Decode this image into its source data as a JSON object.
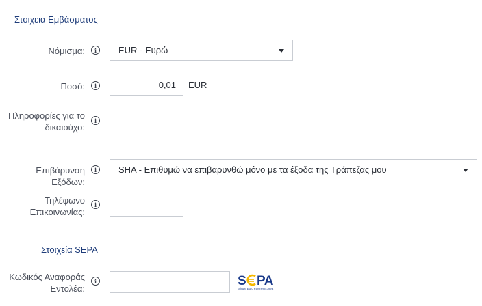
{
  "sections": {
    "remittance_title": "Στοιχεια Εμβάσματος",
    "sepa_title": "Στοιχεία SEPA"
  },
  "fields": {
    "currency": {
      "label": "Νόμισμα:",
      "value": "EUR - Ευρώ"
    },
    "amount": {
      "label": "Ποσό:",
      "value": "0,01",
      "unit": "EUR"
    },
    "beneficiary_info": {
      "label_line1": "Πληροφορίες για το",
      "label_line2": "δικαιούχο:",
      "value": ""
    },
    "charges": {
      "label": "Επιβάρυνση Εξόδων:",
      "value": "SHA - Επιθυμώ να επιβαρυνθώ μόνο με τα έξοδα της Τράπεζας μου"
    },
    "phone": {
      "label_line1": "Τηλέφωνο",
      "label_line2": "Επικοινωνίας:",
      "value": ""
    },
    "mandate_ref": {
      "label_line1": "Κωδικός Αναφοράς",
      "label_line2": "Εντολέα:",
      "value": ""
    }
  },
  "sepa_logo": {
    "wordmark": "SEPA",
    "tagline": "Single Euro Payments Area"
  },
  "icons": {
    "info": "info-icon",
    "dropdown": "chevron-down-icon"
  },
  "colors": {
    "section_title": "#1f3d7a",
    "sepa_blue": "#1a3a8a",
    "sepa_yellow": "#f5b800",
    "border": "#c9cdd3"
  }
}
